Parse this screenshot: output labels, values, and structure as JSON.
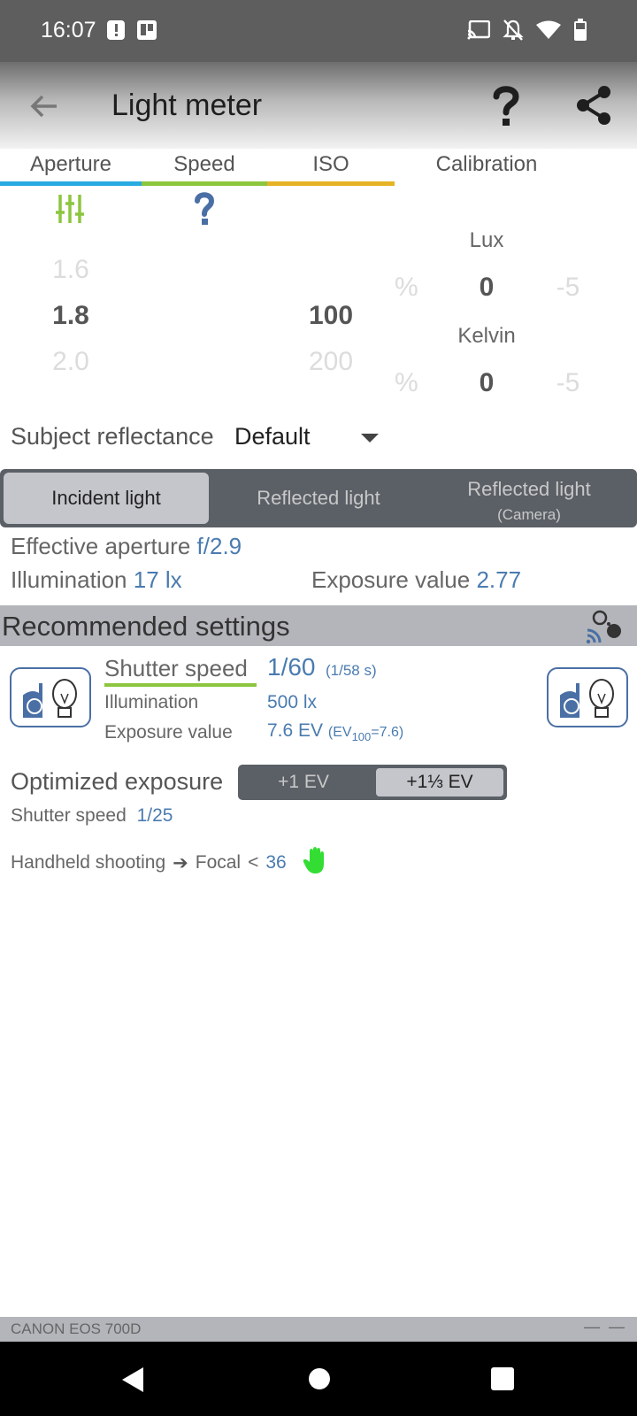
{
  "status_bar": {
    "time": "16:07"
  },
  "app_bar": {
    "title": "Light meter"
  },
  "tabs": [
    {
      "label": "Aperture",
      "color": "#29abe2"
    },
    {
      "label": "Speed",
      "color": "#8cc63f"
    },
    {
      "label": "ISO",
      "color": "#e6b325"
    },
    {
      "label": "Calibration"
    }
  ],
  "aperture_wheel": {
    "prev": "1.6",
    "current": "1.8",
    "next": "2.0"
  },
  "iso_wheel": {
    "current": "100",
    "next": "200"
  },
  "calibration": {
    "lux_label": "Lux",
    "lux_value": "0",
    "lux_right": "-5",
    "lux_left": "%",
    "kelvin_label": "Kelvin",
    "kelvin_value": "0",
    "kelvin_right": "-5",
    "kelvin_left": "%"
  },
  "subject": {
    "label": "Subject reflectance",
    "value": "Default"
  },
  "mode": {
    "incident": "Incident light",
    "reflected": "Reflected light",
    "reflected_camera": "Reflected light",
    "reflected_camera_sub": "(Camera)"
  },
  "readings": {
    "effective_aperture_label": "Effective aperture",
    "effective_aperture_value": "f/2.9",
    "illumination_label": "Illumination",
    "illumination_value": "17 lx",
    "ev_label": "Exposure value",
    "ev_value": "2.77"
  },
  "recommended": {
    "title": "Recommended settings",
    "shutter_label": "Shutter speed",
    "shutter_value": "1/60",
    "shutter_exact": "(1/58 s)",
    "illum_label": "Illumination",
    "illum_value": "500 lx",
    "ev_label": "Exposure value",
    "ev_value": "7.6 EV",
    "ev100_prefix": "(EV",
    "ev100_sub": "100",
    "ev100_suffix": "=7.6)"
  },
  "optimized": {
    "label": "Optimized exposure",
    "options": [
      "+1 EV",
      "+1⅓ EV"
    ],
    "selected": "+1⅓ EV",
    "shutter_label": "Shutter speed",
    "shutter_value": "1/25"
  },
  "handheld": {
    "label": "Handheld shooting",
    "arrow": "➔",
    "focal_label": "Focal",
    "lt": "<",
    "focal_value": "36"
  },
  "footer": {
    "camera": "CANON EOS 700D",
    "dash": "—"
  }
}
